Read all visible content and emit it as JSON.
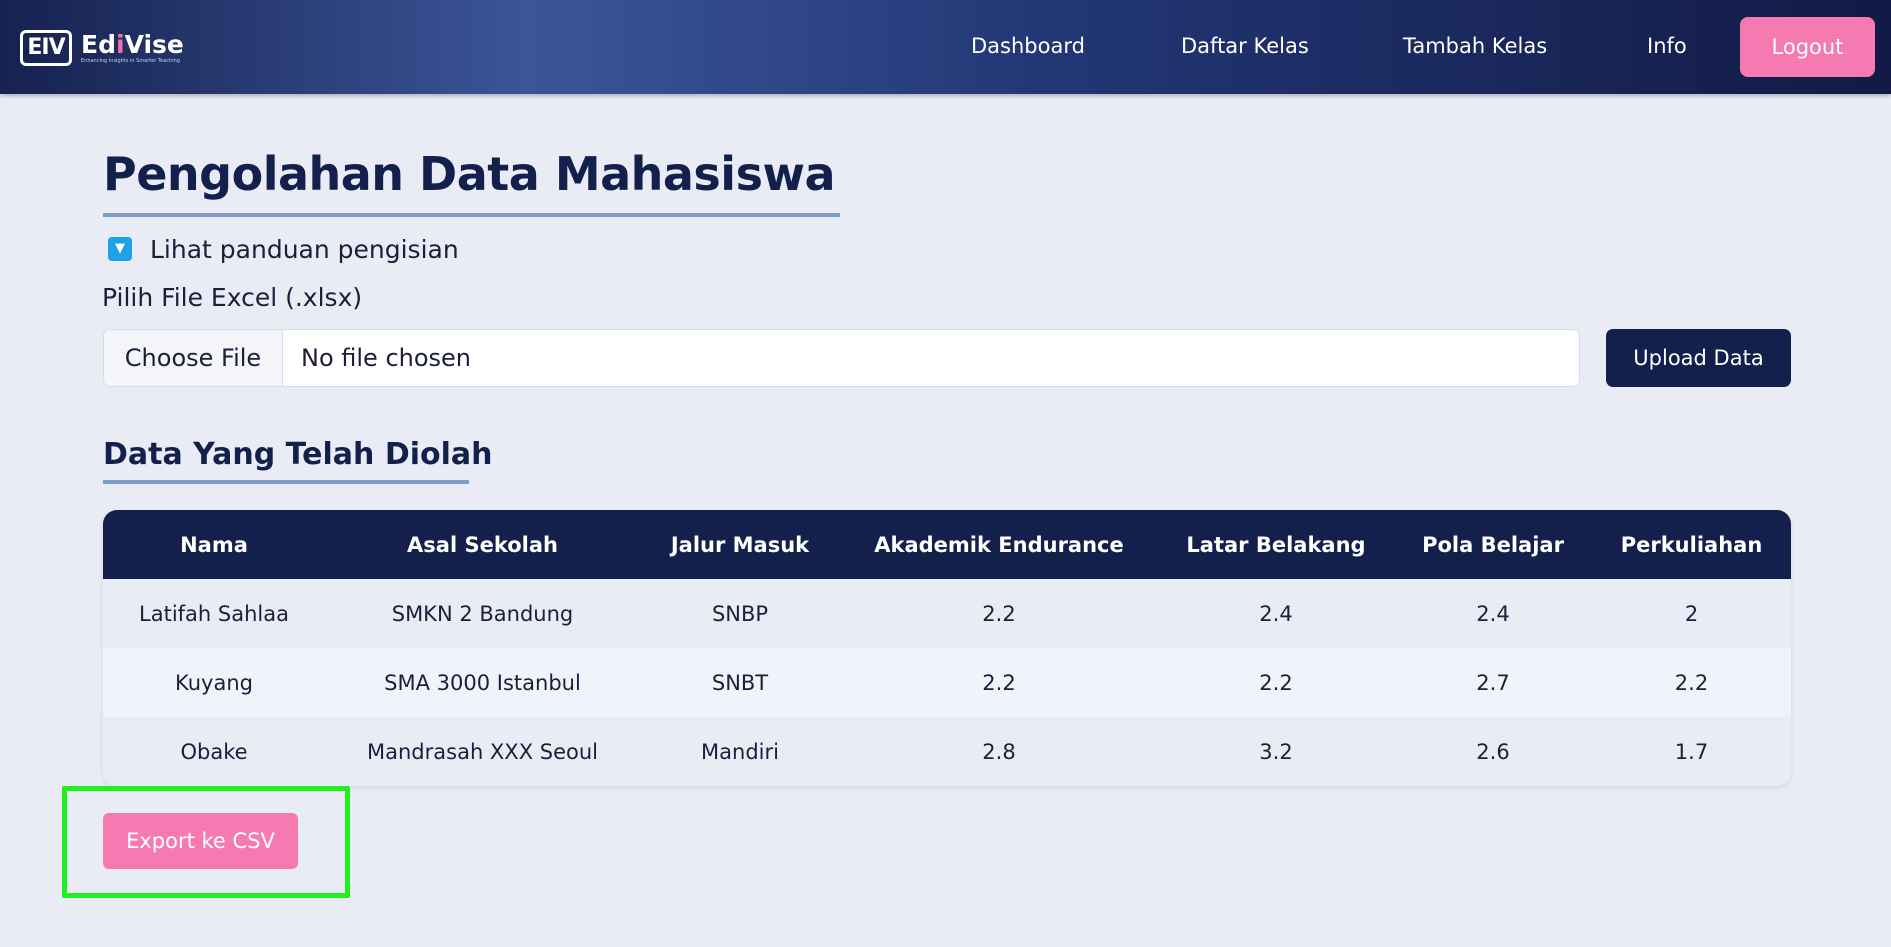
{
  "brand": {
    "mark": "EIV",
    "name_start": "Ed",
    "name_accent": "i",
    "name_end": "Vise",
    "tagline": "Enhancing Insights in Smarter Teaching"
  },
  "nav": {
    "links": [
      "Dashboard",
      "Daftar Kelas",
      "Tambah Kelas",
      "Info"
    ],
    "logout_label": "Logout"
  },
  "page": {
    "title": "Pengolahan Data Mahasiswa",
    "guide_label": "Lihat panduan pengisian",
    "guide_icon": "▼",
    "file_label": "Pilih File Excel (.xlsx)",
    "choose_file_label": "Choose File",
    "file_status": "No file chosen",
    "upload_label": "Upload Data",
    "section_title": "Data Yang Telah Diolah",
    "export_label": "Export ke CSV"
  },
  "table": {
    "headers": [
      "Nama",
      "Asal Sekolah",
      "Jalur Masuk",
      "Akademik Endurance",
      "Latar Belakang",
      "Pola Belajar",
      "Perkuliahan"
    ],
    "rows": [
      [
        "Latifah Sahlaa",
        "SMKN 2 Bandung",
        "SNBP",
        "2.2",
        "2.4",
        "2.4",
        "2"
      ],
      [
        "Kuyang",
        "SMA 3000 Istanbul",
        "SNBT",
        "2.2",
        "2.2",
        "2.7",
        "2.2"
      ],
      [
        "Obake",
        "Mandrasah XXX Seoul",
        "Mandiri",
        "2.8",
        "3.2",
        "2.6",
        "1.7"
      ]
    ]
  },
  "colors": {
    "navy": "#12204b",
    "pink": "#f47ab1",
    "highlight": "#22ee22",
    "checkbox": "#1fa3e6"
  }
}
